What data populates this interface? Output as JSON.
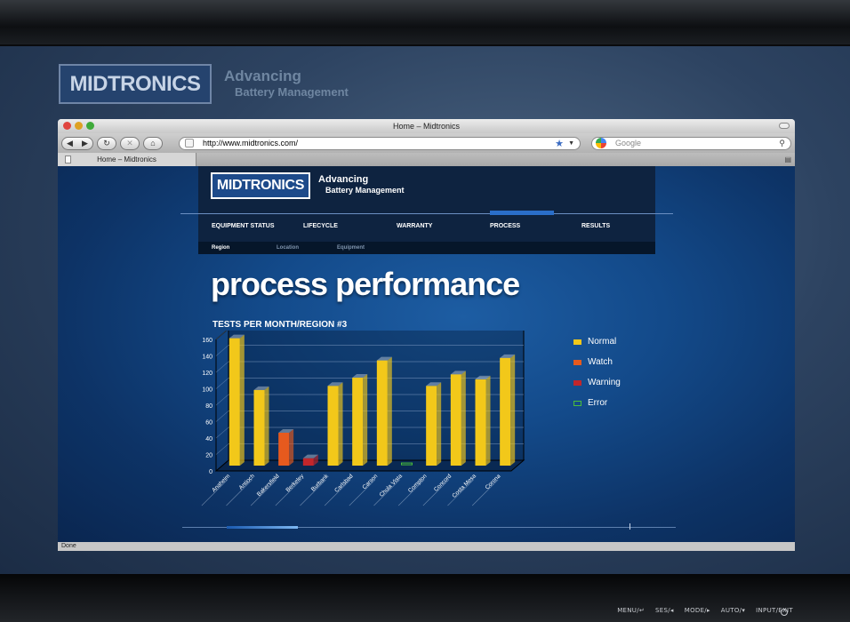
{
  "brand": {
    "logo_text": "MIDTRONICS",
    "tag_line1": "Advancing",
    "tag_line2": "Battery Management"
  },
  "browser": {
    "window_title": "Home  – Midtronics",
    "url": "http://www.midtronics.com/",
    "search_placeholder": "Google",
    "tab_label": "Home  – Midtronics",
    "status": "Done"
  },
  "site": {
    "logo_text": "MIDTRONICS",
    "tag_line1": "Advancing",
    "tag_line2": "Battery Management",
    "nav": [
      "EQUIPMENT STATUS",
      "LIFECYCLE",
      "WARRANTY",
      "PROCESS",
      "RESULTS"
    ],
    "active_nav": "PROCESS",
    "subnav": [
      "Region",
      "Location",
      "Equipment"
    ],
    "active_subnav": "Region",
    "page_title": "process performance"
  },
  "legend": [
    {
      "label": "Normal",
      "color": "#f2c81a"
    },
    {
      "label": "Watch",
      "color": "#e65a1e"
    },
    {
      "label": "Warning",
      "color": "#c2262b"
    },
    {
      "label": "Error",
      "color": "#4bbf3a"
    }
  ],
  "chart_data": {
    "type": "bar",
    "title": "TESTS PER MONTH/REGION #3",
    "categories": [
      "Anaheim",
      "Antioch",
      "Bakersfield",
      "Berkeley",
      "Burbank",
      "Carlsbad",
      "Carson",
      "Chula Vista",
      "Compton",
      "Concord",
      "Costa Mesa",
      "Corona"
    ],
    "values": [
      155,
      92,
      40,
      9,
      97,
      107,
      128,
      1,
      97,
      111,
      105,
      131
    ],
    "status": [
      "Normal",
      "Normal",
      "Watch",
      "Warning",
      "Normal",
      "Normal",
      "Normal",
      "Error",
      "Normal",
      "Normal",
      "Normal",
      "Normal"
    ],
    "yticks": [
      0,
      20,
      40,
      60,
      80,
      100,
      120,
      140,
      160
    ],
    "ylim": [
      0,
      160
    ],
    "grid": true,
    "legend_position": "right"
  },
  "bezel": {
    "controls": [
      "MENU/↵",
      "SES/◂",
      "MODE/▸",
      "AUTO/▾",
      "INPUT/EXIT"
    ]
  }
}
